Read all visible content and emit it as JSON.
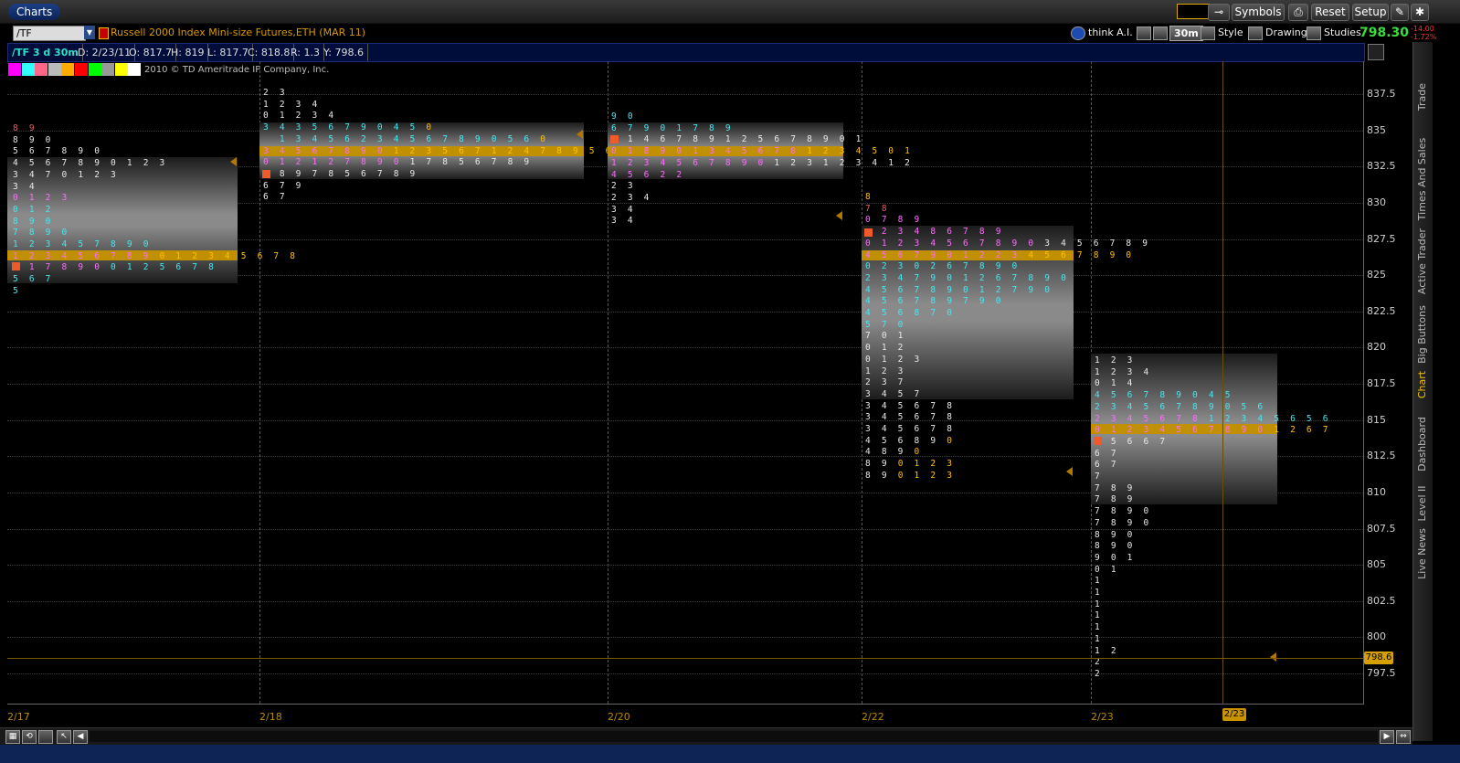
{
  "app": {
    "tab": "Charts",
    "buttons": {
      "symbols": "Symbols",
      "reset": "Reset",
      "setup": "Setup"
    }
  },
  "toolbar": {
    "symbol": "/TF",
    "instrument": "Russell 2000 Index Mini-size Futures,ETH (MAR 11)",
    "think_ai": "think A.I.",
    "timeframe": "30m",
    "style": "Style",
    "drawings": "Drawings",
    "studies": "Studies",
    "last_price": "798.30",
    "change_pts": "-14.00",
    "change_pct": "-1.72%"
  },
  "info": {
    "label": "/TF 3 d 30m",
    "date": "D: 2/23/11",
    "open": "O: 817.7",
    "high": "H: 819",
    "low": "L: 817.7",
    "close": "C: 818.8",
    "range": "R: 1.3",
    "y": "Y: 798.6"
  },
  "legend_colors": [
    "#ff00ff",
    "#33ffff",
    "#ff6688",
    "#bbbbbb",
    "#ffaa00",
    "#ff0000",
    "#00ff00",
    "#999999",
    "#ffff00",
    "#ffffff"
  ],
  "copyright": "2010 © TD Ameritrade IP Company, Inc.",
  "chart_data": {
    "type": "tpo-profile",
    "y_ticks": [
      "837.5",
      "835",
      "832.5",
      "830",
      "827.5",
      "825",
      "822.5",
      "820",
      "817.5",
      "815",
      "812.5",
      "810",
      "807.5",
      "805",
      "802.5",
      "800",
      "797.5"
    ],
    "x_ticks": [
      "2/17",
      "2/18",
      "2/20",
      "2/22",
      "2/23"
    ],
    "current_price": "798.6",
    "cursor_date": "2/23",
    "profiles": [
      {
        "date": "2/17",
        "rows": [
          [
            [
              "8 9",
              "c5"
            ]
          ],
          [
            [
              "8 9 0",
              "c1"
            ]
          ],
          [
            [
              "5 6 7 8 9 0",
              "c1"
            ]
          ],
          [
            [
              "4 5 6 7 8 9 0 1 2 3",
              "c1"
            ]
          ],
          [
            [
              "3 4 7 0 1 2 3",
              "c1"
            ]
          ],
          [
            [
              "3 4",
              "c1"
            ]
          ],
          [
            [
              "0 1 2 3",
              "c2"
            ]
          ],
          [
            [
              "0 1 2",
              "c3"
            ]
          ],
          [
            [
              "8 9 0",
              "c3"
            ]
          ],
          [
            [
              "7 8 9 0",
              "c3"
            ]
          ],
          [
            [
              "1 2 3 4 5 7 8 9 0",
              "c3"
            ]
          ],
          [
            [
              "1 2 3 4 5 6 7 8 9 ",
              "c2"
            ],
            [
              "0 1 2 3 4 5 6 7 8",
              "c4"
            ]
          ],
          [
            [
              "  1 7 8 9 0 ",
              "c2"
            ],
            [
              "0 1 2 5 6 7 8",
              "c3"
            ]
          ],
          [
            [
              "5 6 7",
              "c3"
            ]
          ],
          [
            [
              "5",
              "c3"
            ]
          ]
        ]
      },
      {
        "date": "2/18",
        "rows": [
          [
            [
              "2 3",
              "c1"
            ]
          ],
          [
            [
              "1 2 3 4",
              "c1"
            ]
          ],
          [
            [
              "0 1 2 3 4",
              "c1"
            ]
          ],
          [
            [
              "3 4 3 5 6 7 9 0 4 5 ",
              "c3"
            ],
            [
              "0",
              "c4"
            ]
          ],
          [
            [
              "  1 3 4 5 6 2 3 4 5 6 7 8 9 0 5 6 ",
              "c3"
            ],
            [
              "0",
              "c4"
            ]
          ],
          [
            [
              "3 4 5 6 7 8 9 0 ",
              "c2"
            ],
            [
              "1 2 3 5 6 7 1 2 4 7 8 9 5 6 7 8 9 0",
              "c4"
            ]
          ],
          [
            [
              "0 1 2 1 2 7 8 9 0 ",
              "c2"
            ],
            [
              "1 7 8 5 6 7 8 9",
              "c1"
            ]
          ],
          [
            [
              "  8 9 7 8 5 6 7 8 9",
              "c1"
            ]
          ],
          [
            [
              "6 7 9",
              "c1"
            ]
          ],
          [
            [
              "6 7",
              "c1"
            ]
          ]
        ]
      },
      {
        "date": "2/20",
        "rows": [
          [
            [
              "9 0",
              "c3"
            ]
          ],
          [
            [
              "6 7 9 0 1 7 8 9",
              "c3"
            ]
          ],
          [
            [
              "  1 4 6 7 8 9 1 2 5 6 7 8 9 0 1",
              "c1"
            ]
          ],
          [
            [
              "0 1 8 9 0 1 3 4 5 6 7 8 ",
              "c2"
            ],
            [
              "1 2 3 4 5 0 1",
              "c4"
            ]
          ],
          [
            [
              "1 2 3 4 5 6 7 8 9 0 ",
              "c2"
            ],
            [
              "1 2 3 1 2 3 4 1 2",
              "c1"
            ]
          ],
          [
            [
              "4 5 6 2 2",
              "c2"
            ]
          ],
          [
            [
              "2 3",
              "c1"
            ]
          ],
          [
            [
              "2 3 4",
              "c1"
            ]
          ],
          [
            [
              "3 4",
              "c1"
            ]
          ],
          [
            [
              "3 4",
              "c1"
            ]
          ]
        ]
      },
      {
        "date": "2/22",
        "rows": [
          [
            [
              "8",
              "c4"
            ]
          ],
          [
            [
              "7 8",
              "c5"
            ]
          ],
          [
            [
              "0 7 8 9",
              "c2"
            ]
          ],
          [
            [
              "  2 3 4 8 6 7 8 9",
              "c2"
            ]
          ],
          [
            [
              "0 1 2 3 4 5 6 7 8 9 0 ",
              "c2"
            ],
            [
              "3 4 5 6 7 8 9",
              "c1"
            ]
          ],
          [
            [
              "4 5 6 7 9 0 1 2 2 3 ",
              "c2"
            ],
            [
              "4 5 6 7 8 9 0",
              "c4"
            ]
          ],
          [
            [
              "0 2 3 0 2 6 7 8 9 0",
              "c3"
            ]
          ],
          [
            [
              "2 3 4 7 9 0 1 2 6 7 8 9 0",
              "c3"
            ]
          ],
          [
            [
              "4 5 6 7 8 9 0 1 2 7 9 0",
              "c3"
            ]
          ],
          [
            [
              "4 5 6 7 8 9 7 9 0",
              "c3"
            ]
          ],
          [
            [
              "4 5 6 8 7 0",
              "c3"
            ]
          ],
          [
            [
              "5 7 0",
              "c3"
            ]
          ],
          [
            [
              "7 0 1",
              "c1"
            ]
          ],
          [
            [
              "0 1 2",
              "c1"
            ]
          ],
          [
            [
              "0 1 2 3",
              "c1"
            ]
          ],
          [
            [
              "1 2 3",
              "c1"
            ]
          ],
          [
            [
              "2 3 7",
              "c1"
            ]
          ],
          [
            [
              "3 4 5 7",
              "c1"
            ]
          ],
          [
            [
              "3 4 5 6 7 8",
              "c1"
            ]
          ],
          [
            [
              "3 4 5 6 7 8",
              "c1"
            ]
          ],
          [
            [
              "3 4 5 6 7 8",
              "c1"
            ]
          ],
          [
            [
              "4 5 6 8 9 ",
              "c1"
            ],
            [
              "0",
              "c4"
            ]
          ],
          [
            [
              "4 8 9 ",
              "c1"
            ],
            [
              "0",
              "c4"
            ]
          ],
          [
            [
              "8 9 ",
              "c1"
            ],
            [
              "0 1 2 3",
              "c4"
            ]
          ],
          [
            [
              "8 9 ",
              "c1"
            ],
            [
              "0 1 2 3",
              "c4"
            ]
          ]
        ]
      },
      {
        "date": "2/23",
        "rows": [
          [
            [
              "1 2 3",
              "c1"
            ]
          ],
          [
            [
              "1 2 3 4",
              "c1"
            ]
          ],
          [
            [
              "0 1 4",
              "c1"
            ]
          ],
          [
            [
              "4 5 6 7 8 9 0 4 5",
              "c3"
            ]
          ],
          [
            [
              "2 3 4 5 6 7 8 9 0 5 6",
              "c3"
            ]
          ],
          [
            [
              "2 3 4 5 6 7 8 ",
              "c2"
            ],
            [
              "1 2 3 4 5 6 5 6",
              "c3"
            ]
          ],
          [
            [
              "0 1 2 3 4 5 6 7 8 9 0 ",
              "c2"
            ],
            [
              "1 2 6 7",
              "c4"
            ]
          ],
          [
            [
              "  5 6 6 7",
              "c1"
            ]
          ],
          [
            [
              "6 7",
              "c1"
            ]
          ],
          [
            [
              "6 7",
              "c1"
            ]
          ],
          [
            [
              "7",
              "c1"
            ]
          ],
          [
            [
              "7 8 9",
              "c1"
            ]
          ],
          [
            [
              "7 8 9",
              "c1"
            ]
          ],
          [
            [
              "7 8 9 0",
              "c1"
            ]
          ],
          [
            [
              "7 8 9 0",
              "c1"
            ]
          ],
          [
            [
              "8 9 0",
              "c1"
            ]
          ],
          [
            [
              "8 9 0",
              "c1"
            ]
          ],
          [
            [
              "9 0 1",
              "c1"
            ]
          ],
          [
            [
              "0 1",
              "c1"
            ]
          ],
          [
            [
              "1",
              "c1"
            ]
          ],
          [
            [
              "1",
              "c1"
            ]
          ],
          [
            [
              "1",
              "c1"
            ]
          ],
          [
            [
              "1",
              "c1"
            ]
          ],
          [
            [
              "1",
              "c1"
            ]
          ],
          [
            [
              "1",
              "c1"
            ]
          ],
          [
            [
              "1 2",
              "c1"
            ]
          ],
          [
            [
              "2",
              "c1"
            ]
          ],
          [
            [
              "2",
              "c1"
            ]
          ]
        ]
      }
    ]
  },
  "side_tabs": [
    "Trade",
    "Times And Sales",
    "Active Trader",
    "Big Buttons",
    "Chart",
    "Dashboard",
    "Level II",
    "Live News"
  ]
}
